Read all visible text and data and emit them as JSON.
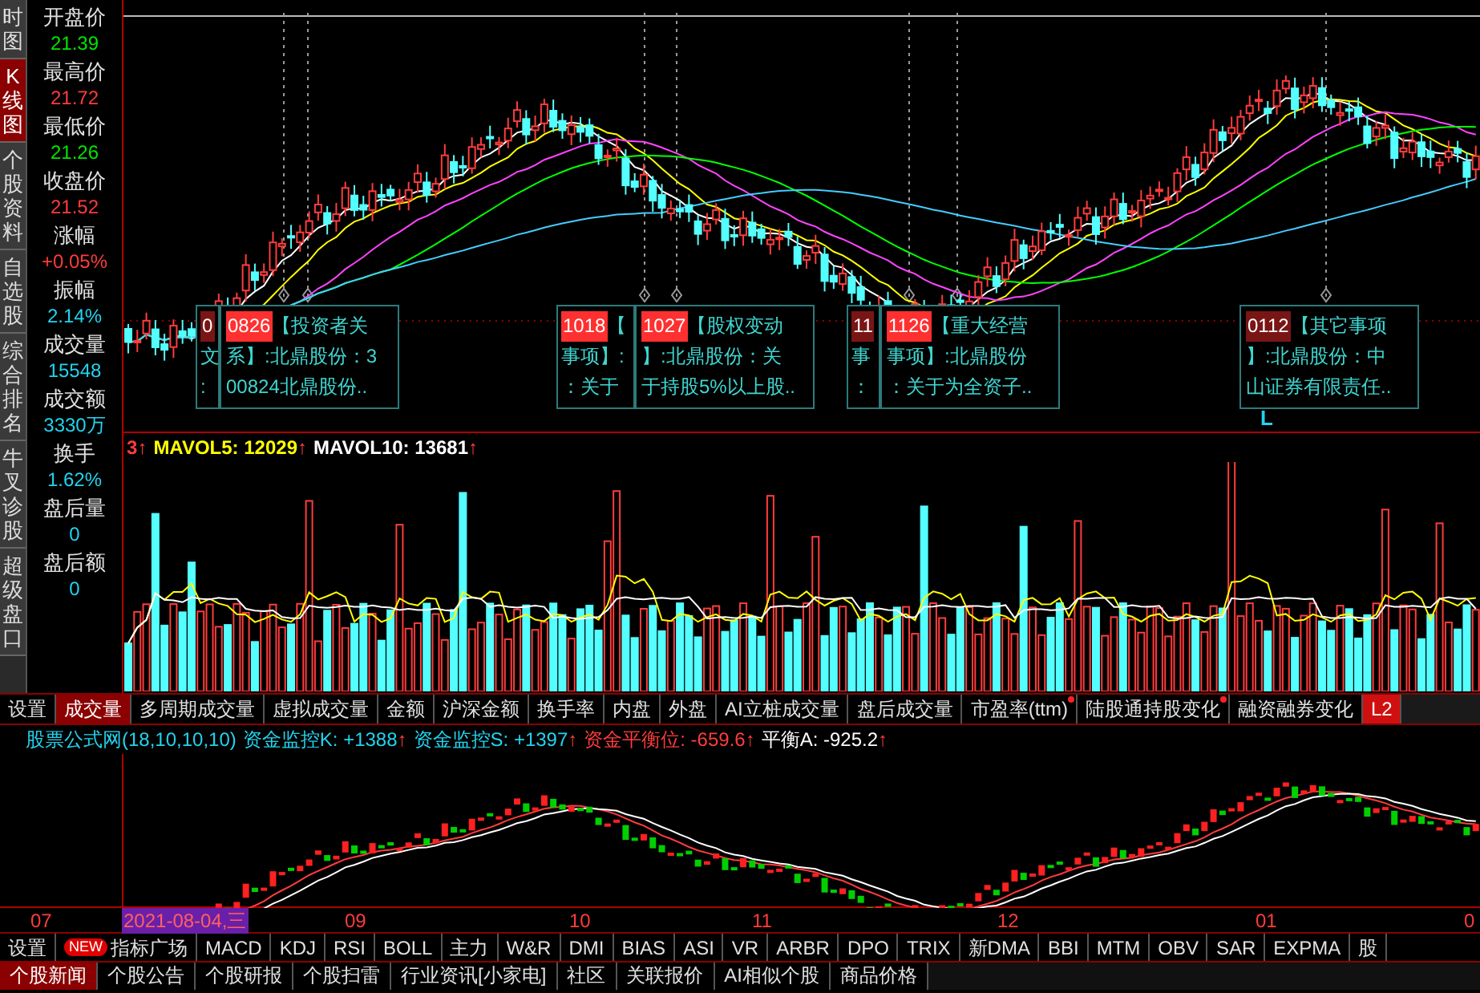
{
  "side_tabs": [
    {
      "label": "时图",
      "selected": false
    },
    {
      "label": "K线图",
      "selected": true
    },
    {
      "label": "个股资料",
      "selected": false
    },
    {
      "label": "自选股",
      "selected": false
    },
    {
      "label": "综合排名",
      "selected": false
    },
    {
      "label": "牛叉诊股",
      "selected": false
    },
    {
      "label": "超级盘口",
      "selected": false
    }
  ],
  "quote_panel": [
    {
      "label": "开盘价",
      "value": "21.39",
      "color": "#00e600"
    },
    {
      "label": "最高价",
      "value": "21.72",
      "color": "#ff3c3c"
    },
    {
      "label": "最低价",
      "value": "21.26",
      "color": "#00e600"
    },
    {
      "label": "收盘价",
      "value": "21.52",
      "color": "#ff3c3c"
    },
    {
      "label": "涨幅",
      "value": "+0.05%",
      "color": "#ff3c3c"
    },
    {
      "label": "振幅",
      "value": "2.14%",
      "color": "#22d3ee"
    },
    {
      "label": "成交量",
      "value": "15548",
      "color": "#22d3ee"
    },
    {
      "label": "成交额",
      "value": "3330万",
      "color": "#22d3ee"
    },
    {
      "label": "换手",
      "value": "1.62%",
      "color": "#22d3ee"
    },
    {
      "label": "盘后量",
      "value": "0",
      "color": "#22d3ee"
    },
    {
      "label": "盘后额",
      "value": "0",
      "color": "#22d3ee"
    }
  ],
  "event_notes": [
    {
      "kind": "covered",
      "code": "0",
      "highlighted": false,
      "lines": [
        "文",
        ":"
      ]
    },
    {
      "kind": "full",
      "code": "0826",
      "highlighted": true,
      "head": "【投资者关",
      "lines": [
        "系】:北鼎股份：3",
        "00824北鼎股份.."
      ]
    },
    {
      "kind": "covered",
      "code": "1018",
      "highlighted": true,
      "head": "【",
      "lines": [
        "事项】:",
        "：关于"
      ]
    },
    {
      "kind": "full",
      "code": "1027",
      "highlighted": true,
      "head": "【股权变动",
      "lines": [
        "】:北鼎股份：关",
        "于持股5%以上股.."
      ]
    },
    {
      "kind": "covered",
      "code": "11",
      "highlighted": false,
      "lines": [
        "事",
        "："
      ]
    },
    {
      "kind": "full",
      "code": "1126",
      "highlighted": true,
      "head": "【重大经营",
      "lines": [
        "事项】:北鼎股份",
        "：关于为全资子.."
      ]
    },
    {
      "kind": "full",
      "code": "0112",
      "highlighted": false,
      "head": "【其它事项",
      "lines": [
        "】:北鼎股份：中",
        "山证券有限责任.."
      ]
    }
  ],
  "chart_marker": "L",
  "volume_header": [
    {
      "text": "3",
      "color": "#ff3c3c"
    },
    {
      "text": "MAVOL5: 12029",
      "color": "#ffff00"
    },
    {
      "text": "MAVOL10: 13681",
      "color": "#ffffff"
    }
  ],
  "volume_tabs": [
    {
      "label": "设置",
      "selected": false,
      "dot": false
    },
    {
      "label": "成交量",
      "selected": true,
      "dot": false
    },
    {
      "label": "多周期成交量",
      "selected": false,
      "dot": false
    },
    {
      "label": "虚拟成交量",
      "selected": false,
      "dot": false
    },
    {
      "label": "金额",
      "selected": false,
      "dot": false
    },
    {
      "label": "沪深金额",
      "selected": false,
      "dot": false
    },
    {
      "label": "换手率",
      "selected": false,
      "dot": false
    },
    {
      "label": "内盘",
      "selected": false,
      "dot": false
    },
    {
      "label": "外盘",
      "selected": false,
      "dot": false
    },
    {
      "label": "AI立桩成交量",
      "selected": false,
      "dot": false
    },
    {
      "label": "盘后成交量",
      "selected": false,
      "dot": false
    },
    {
      "label": "市盈率(ttm)",
      "selected": false,
      "dot": true
    },
    {
      "label": "陆股通持股变化",
      "selected": false,
      "dot": true
    },
    {
      "label": "融资融券变化",
      "selected": false,
      "dot": false
    },
    {
      "label": "L2",
      "selected": false,
      "dot": false
    }
  ],
  "indicator_header": [
    {
      "text": "股票公式网(18,10,10,10)",
      "color": "#22d3ee",
      "arrow": false
    },
    {
      "text": "资金监控K: +1388",
      "color": "#22d3ee",
      "arrow": true
    },
    {
      "text": "资金监控S: +1397",
      "color": "#22d3ee",
      "arrow": true
    },
    {
      "text": "资金平衡位: -659.6",
      "color": "#ff3c3c",
      "arrow": true
    },
    {
      "text": "平衡A: -925.2",
      "color": "#ffffff",
      "arrow": true
    }
  ],
  "arrow_glyph": "↑",
  "date_axis": [
    {
      "label": "07",
      "selected": false
    },
    {
      "label": "2021-08-04,三",
      "selected": true
    },
    {
      "label": "09",
      "selected": false
    },
    {
      "label": "10",
      "selected": false
    },
    {
      "label": "11",
      "selected": false
    },
    {
      "label": "12",
      "selected": false
    },
    {
      "label": "01",
      "selected": false
    },
    {
      "label": "0",
      "selected": false
    }
  ],
  "indicator_tabs": [
    {
      "label": "设置"
    },
    {
      "label": "指标广场",
      "badge": "NEW"
    },
    {
      "label": "MACD"
    },
    {
      "label": "KDJ"
    },
    {
      "label": "RSI"
    },
    {
      "label": "BOLL"
    },
    {
      "label": "主力"
    },
    {
      "label": "W&R"
    },
    {
      "label": "DMI"
    },
    {
      "label": "BIAS"
    },
    {
      "label": "ASI"
    },
    {
      "label": "VR"
    },
    {
      "label": "ARBR"
    },
    {
      "label": "DPO"
    },
    {
      "label": "TRIX"
    },
    {
      "label": "新DMA"
    },
    {
      "label": "BBI"
    },
    {
      "label": "MTM"
    },
    {
      "label": "OBV"
    },
    {
      "label": "SAR"
    },
    {
      "label": "EXPMA"
    },
    {
      "label": "股"
    }
  ],
  "news_tabs": [
    {
      "label": "个股新闻",
      "selected": true
    },
    {
      "label": "个股公告",
      "selected": false
    },
    {
      "label": "个股研报",
      "selected": false
    },
    {
      "label": "个股扫雷",
      "selected": false
    },
    {
      "label": "行业资讯[小家电]",
      "selected": false
    },
    {
      "label": "社区",
      "selected": false
    },
    {
      "label": "关联报价",
      "selected": false
    },
    {
      "label": "AI相似个股",
      "selected": false
    },
    {
      "label": "商品价格",
      "selected": false
    }
  ]
}
